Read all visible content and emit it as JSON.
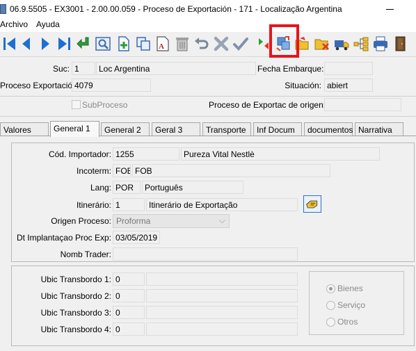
{
  "window": {
    "title": "06.9.5505 - EX3001 - 2.00.00.059 - Proceso de Exportación - 171 - Localização Argentina"
  },
  "menu": {
    "items": [
      "Archivo",
      "Ayuda"
    ]
  },
  "toolbar": {
    "buttons": [
      "first-record",
      "previous-record",
      "next-record",
      "last-record",
      "go-to",
      "search",
      "add",
      "copy",
      "edit",
      "delete",
      "undo",
      "cancel",
      "confirm",
      "refresh-data",
      "generate-documents",
      "open-folder",
      "remove-folder",
      "truck",
      "hierarchy",
      "print",
      "exit"
    ]
  },
  "header": {
    "suc_label": "Suc:",
    "suc_code": "1",
    "suc_name": "Loc Argentina",
    "fecha_embarque_label": "Fecha Embarque:",
    "fecha_embarque_value": "",
    "proceso_label": "Proceso Exportación:",
    "proceso_value": "4079",
    "situacion_label": "Situación:",
    "situacion_value": "abiert",
    "subproceso_label": "SubProceso",
    "proceso_origen_label": "Proceso de Exportac de origen:",
    "proceso_origen_value": ""
  },
  "tabs": [
    "Valores",
    "General 1",
    "General 2",
    "Geral 3",
    "Transporte",
    "Inf Docum",
    "documentos",
    "Narrativa"
  ],
  "active_tab": "General 1",
  "general1": {
    "importador_label": "Cód. Importador:",
    "importador_code": "1255",
    "importador_name": "Pureza Vital Nestlè",
    "incoterm_label": "Incoterm:",
    "incoterm_code": "FOB",
    "incoterm_desc": "FOB",
    "lang_label": "Lang:",
    "lang_code": "POR",
    "lang_desc": "Português",
    "itinerario_label": "Itinerário:",
    "itinerario_code": "1",
    "itinerario_desc": "Itinerário de Exportação",
    "origen_label": "Origen Proceso:",
    "origen_value": "Proforma",
    "dt_label": "Dt Implantaçao Proc Exp:",
    "dt_value": "03/05/2019",
    "trader_label": "Nomb Trader:",
    "trader_value": ""
  },
  "transbordo": [
    {
      "label": "Ubic Transbordo 1:",
      "code": "0",
      "desc": ""
    },
    {
      "label": "Ubic Transbordo 2:",
      "code": "0",
      "desc": ""
    },
    {
      "label": "Ubic Transbordo 3:",
      "code": "0",
      "desc": ""
    },
    {
      "label": "Ubic Transbordo 4:",
      "code": "0",
      "desc": ""
    }
  ],
  "radio": {
    "options": [
      "Bienes",
      "Serviço",
      "Otros"
    ],
    "selected": "Bienes"
  },
  "colors": {
    "highlight": "#e8141b",
    "nav_blue": "#1f6fd1",
    "arrow_green": "#2e9d3a"
  }
}
